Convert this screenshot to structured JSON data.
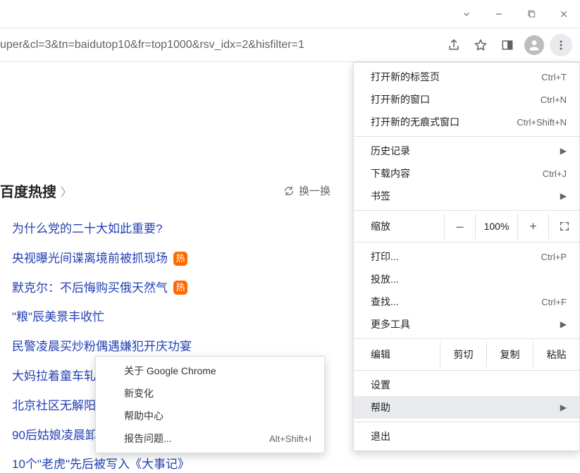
{
  "url": "uper&cl=3&tn=baidutop10&fr=top1000&rsv_idx=2&hisfilter=1",
  "hot": {
    "title": "百度热搜",
    "refresh": "换一换",
    "items": [
      {
        "text": "为什么党的二十大如此重要?",
        "badge": ""
      },
      {
        "text": "央视曝光间谍离境前被抓现场",
        "badge": "热"
      },
      {
        "text": "默克尔：不后悔购买俄天然气",
        "badge": "热"
      },
      {
        "text": "\"粮\"辰美景丰收忙",
        "badge": ""
      },
      {
        "text": "民警凌晨买炒粉偶遇嫌犯开庆功宴",
        "badge": ""
      },
      {
        "text": "大妈拉着童车轧",
        "badge": ""
      },
      {
        "text": "北京社区无解阳",
        "badge": ""
      },
      {
        "text": "90后姑娘凌晨卸",
        "badge": ""
      },
      {
        "text": "10个\"老虎\"先后被写入《大事记》",
        "badge": ""
      }
    ]
  },
  "menu": {
    "newTab": {
      "label": "打开新的标签页",
      "shortcut": "Ctrl+T"
    },
    "newWindow": {
      "label": "打开新的窗口",
      "shortcut": "Ctrl+N"
    },
    "incognito": {
      "label": "打开新的无痕式窗口",
      "shortcut": "Ctrl+Shift+N"
    },
    "history": {
      "label": "历史记录"
    },
    "downloads": {
      "label": "下载内容",
      "shortcut": "Ctrl+J"
    },
    "bookmarks": {
      "label": "书签"
    },
    "zoom": {
      "label": "缩放",
      "minus": "–",
      "value": "100%",
      "plus": "+"
    },
    "print": {
      "label": "打印...",
      "shortcut": "Ctrl+P"
    },
    "cast": {
      "label": "投放..."
    },
    "find": {
      "label": "查找...",
      "shortcut": "Ctrl+F"
    },
    "moreTools": {
      "label": "更多工具"
    },
    "edit": {
      "label": "编辑",
      "cut": "剪切",
      "copy": "复制",
      "paste": "粘贴"
    },
    "settings": {
      "label": "设置"
    },
    "help": {
      "label": "帮助"
    },
    "exit": {
      "label": "退出"
    }
  },
  "helpSub": {
    "about": "关于 Google Chrome",
    "whatsnew": "新变化",
    "helpCenter": "帮助中心",
    "report": {
      "label": "报告问题...",
      "shortcut": "Alt+Shift+I"
    }
  }
}
